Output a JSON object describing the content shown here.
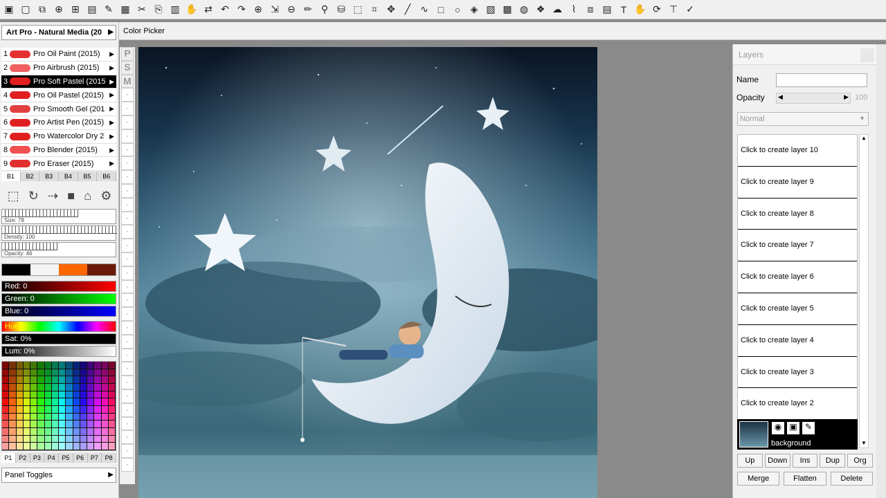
{
  "toolbar": {
    "icons": [
      "save-icon",
      "new-icon",
      "copy-icon",
      "paste-icon",
      "export-icon",
      "doc-icon",
      "brush-icon",
      "image-icon",
      "scissors-icon",
      "copy2-icon",
      "clipboard-icon",
      "grab-icon",
      "swap-icon",
      "undo-icon",
      "redo-icon",
      "zoom-in-icon",
      "fit-icon",
      "zoom-out-icon",
      "pen-icon",
      "eyedropper-icon",
      "bucket-icon",
      "select-rect-icon",
      "crop-icon",
      "move-icon",
      "line-icon",
      "curve-icon",
      "rect-icon",
      "ellipse-icon",
      "fill-icon",
      "gradient-icon",
      "mesh-icon",
      "texture-icon",
      "pattern-icon",
      "smudge-icon",
      "warp-icon",
      "clone-icon",
      "layers-icon",
      "text-icon",
      "hand-icon",
      "rotate-icon",
      "transform-icon",
      "settings-icon"
    ]
  },
  "subbar": {
    "label": "Color Picker"
  },
  "presets": {
    "header": "Art Pro - Natural Media (20",
    "brushes": [
      {
        "num": "1",
        "label": "Pro Oil Paint (2015)",
        "color": "#e53030"
      },
      {
        "num": "2",
        "label": "Pro Airbrush (2015)",
        "color": "#f06060"
      },
      {
        "num": "3",
        "label": "Pro Soft Pastel (2015",
        "color": "#e02020"
      },
      {
        "num": "4",
        "label": "Pro Oil Pastel (2015)",
        "color": "#e02020"
      },
      {
        "num": "5",
        "label": "Pro Smooth Gel (201",
        "color": "#e04040"
      },
      {
        "num": "6",
        "label": "Pro Artist Pen (2015)",
        "color": "#e02020"
      },
      {
        "num": "7",
        "label": "Pro Watercolor Dry 2",
        "color": "#e02020"
      },
      {
        "num": "8",
        "label": "Pro Blender (2015)",
        "color": "#f05050"
      },
      {
        "num": "9",
        "label": "Pro Eraser (2015)",
        "color": "#e03030"
      }
    ],
    "btabs": [
      "B1",
      "B2",
      "B3",
      "B4",
      "B5",
      "B6"
    ]
  },
  "sliders": {
    "size": "Size: 78",
    "density": "Density: 100",
    "opacity": "Opacity: 46"
  },
  "color": {
    "red": "Red: 0",
    "green": "Green: 0",
    "blue": "Blue: 0",
    "hue": "Hue: 0",
    "sat": "Sat: 0%",
    "lum": "Lum: 0%",
    "swatches": [
      "#000000",
      "#f4f4f4",
      "#ff6600",
      "#6b1a0a"
    ]
  },
  "palette_tabs": [
    "P1",
    "P2",
    "P3",
    "P4",
    "P5",
    "P6",
    "P7",
    "P8"
  ],
  "panel_toggles": "Panel Toggles",
  "vstrip_letters": [
    "P",
    "S",
    "M"
  ],
  "layers": {
    "title": "Layers",
    "name_label": "Name",
    "opacity_label": "Opacity",
    "opacity_value": "100",
    "mode": "Normal",
    "items": [
      "Click to create layer 10",
      "Click to create layer 9",
      "Click to create layer 8",
      "Click to create layer 7",
      "Click to create layer 6",
      "Click to create layer 5",
      "Click to create layer 4",
      "Click to create layer 3",
      "Click to create layer 2"
    ],
    "background_label": "background",
    "buttons_row1": [
      "Up",
      "Down",
      "Ins",
      "Dup",
      "Org"
    ],
    "buttons_row2": [
      "Merge",
      "Flatten",
      "Delete"
    ]
  }
}
